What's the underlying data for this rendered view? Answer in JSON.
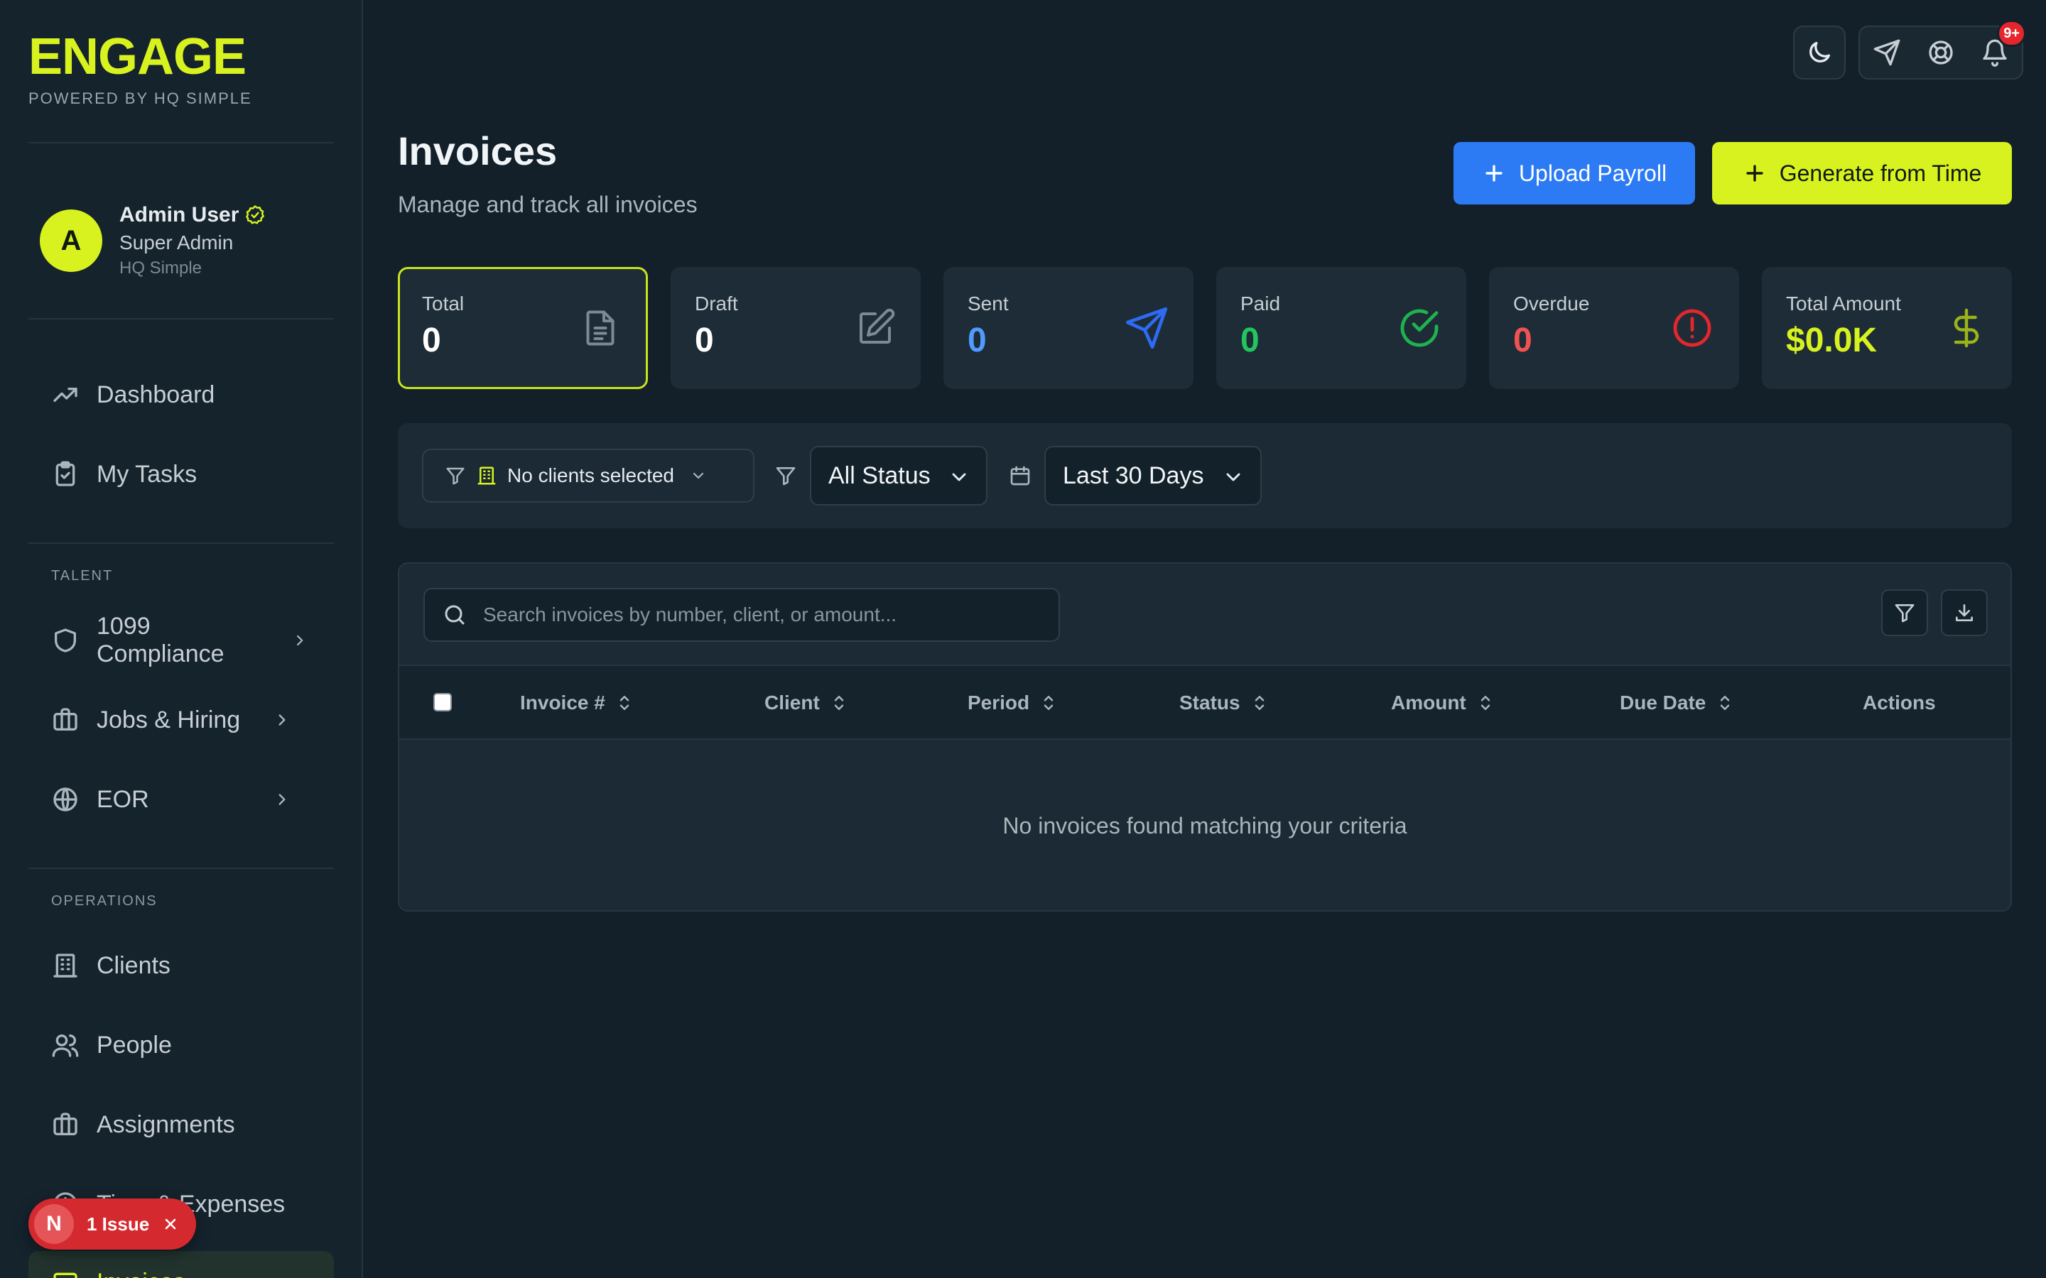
{
  "brand": {
    "name": "ENGAGE",
    "tagline": "POWERED BY HQ SIMPLE"
  },
  "user": {
    "initial": "A",
    "name": "Admin User",
    "role": "Super Admin",
    "org": "HQ Simple"
  },
  "sidebar": {
    "main": [
      {
        "label": "Dashboard",
        "icon": "trending-up-icon"
      },
      {
        "label": "My Tasks",
        "icon": "clipboard-check-icon"
      }
    ],
    "talent_label": "TALENT",
    "talent": [
      {
        "label": "1099 Compliance",
        "icon": "shield-icon"
      },
      {
        "label": "Jobs & Hiring",
        "icon": "briefcase-icon"
      },
      {
        "label": "EOR",
        "icon": "globe-icon"
      }
    ],
    "operations_label": "OPERATIONS",
    "operations": [
      {
        "label": "Clients",
        "icon": "building-icon"
      },
      {
        "label": "People",
        "icon": "users-icon"
      },
      {
        "label": "Assignments",
        "icon": "briefcase-icon"
      },
      {
        "label": "Time & Expenses",
        "icon": "clock-icon"
      },
      {
        "label": "Invoices",
        "icon": "receipt-icon",
        "active": true
      }
    ]
  },
  "issue": {
    "initial": "N",
    "label": "1 Issue"
  },
  "topbar": {
    "notifications_badge": "9+"
  },
  "page": {
    "title": "Invoices",
    "subtitle": "Manage and track all invoices"
  },
  "actions": {
    "upload": "Upload Payroll",
    "generate": "Generate from Time"
  },
  "stats": [
    {
      "label": "Total",
      "value": "0",
      "color": "#ffffff",
      "icon": "document-icon"
    },
    {
      "label": "Draft",
      "value": "0",
      "color": "#ffffff",
      "icon": "edit-icon"
    },
    {
      "label": "Sent",
      "value": "0",
      "color": "#4f9bff",
      "icon": "send-icon"
    },
    {
      "label": "Paid",
      "value": "0",
      "color": "#22c55e",
      "icon": "check-circle-icon"
    },
    {
      "label": "Overdue",
      "value": "0",
      "color": "#f05252",
      "icon": "alert-circle-icon"
    },
    {
      "label": "Total Amount",
      "value": "$0.0K",
      "color": "#d8f21f",
      "icon": "dollar-icon"
    }
  ],
  "filters": {
    "clients": "No clients selected",
    "status": "All Status",
    "range": "Last 30 Days"
  },
  "table": {
    "search_placeholder": "Search invoices by number, client, or amount...",
    "columns": [
      "Invoice #",
      "Client",
      "Period",
      "Status",
      "Amount",
      "Due Date",
      "Actions"
    ],
    "empty": "No invoices found matching your criteria"
  },
  "colors": {
    "accent": "#d8f21f",
    "primary": "#2d7bf4",
    "background": "#13202a"
  }
}
